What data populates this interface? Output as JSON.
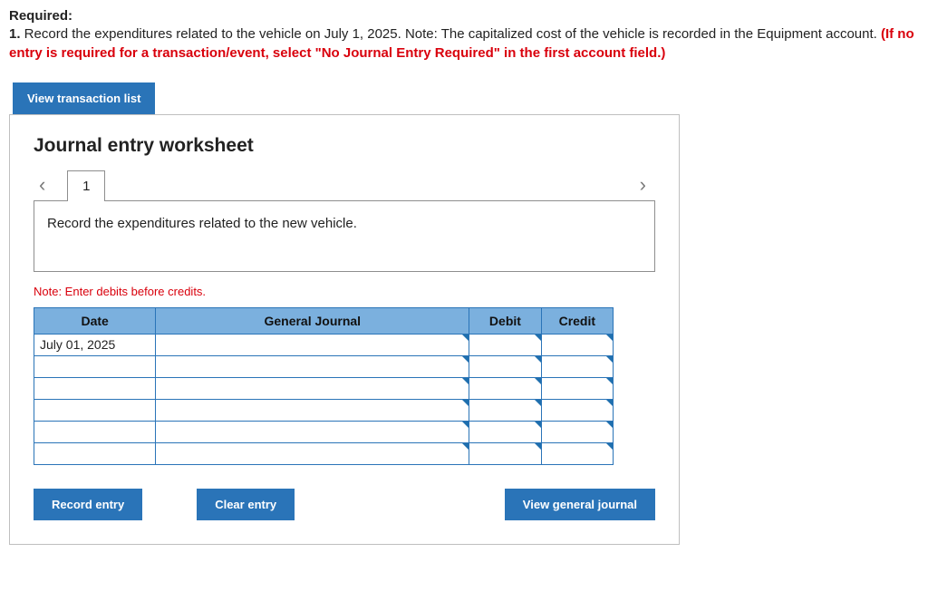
{
  "required": {
    "label": "Required:",
    "item_num": "1.",
    "text_a": " Record the expenditures related to the vehicle on July 1, 2025. Note: The capitalized cost of the vehicle is recorded in the Equipment account. ",
    "text_red": "(If no entry is required for a transaction/event, select \"No Journal Entry Required\" in the first account field.)"
  },
  "buttons": {
    "view_transaction_list": "View transaction list",
    "record_entry": "Record entry",
    "clear_entry": "Clear entry",
    "view_general_journal": "View general journal"
  },
  "worksheet": {
    "title": "Journal entry worksheet",
    "tab_label": "1",
    "instruction": "Record the expenditures related to the new vehicle.",
    "note": "Note: Enter debits before credits.",
    "headers": {
      "date": "Date",
      "general_journal": "General Journal",
      "debit": "Debit",
      "credit": "Credit"
    },
    "rows": [
      {
        "date": "July 01, 2025",
        "gj": "",
        "debit": "",
        "credit": ""
      },
      {
        "date": "",
        "gj": "",
        "debit": "",
        "credit": ""
      },
      {
        "date": "",
        "gj": "",
        "debit": "",
        "credit": ""
      },
      {
        "date": "",
        "gj": "",
        "debit": "",
        "credit": ""
      },
      {
        "date": "",
        "gj": "",
        "debit": "",
        "credit": ""
      },
      {
        "date": "",
        "gj": "",
        "debit": "",
        "credit": ""
      }
    ]
  }
}
